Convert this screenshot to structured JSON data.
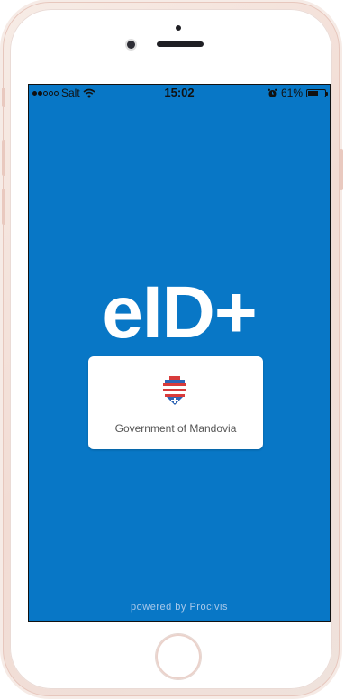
{
  "status_bar": {
    "carrier": "Salt",
    "time": "15:02",
    "battery_percent": "61%",
    "battery_level": 0.61,
    "signal_bars_filled": 2,
    "signal_bars_total": 5,
    "icons": [
      "signal-dots-icon",
      "wifi-icon",
      "alarm-icon",
      "battery-icon"
    ]
  },
  "app": {
    "logo_text": "eID+",
    "background_color": "#0877c6"
  },
  "government_card": {
    "name": "Government of Mandovia",
    "emblem_icon": "coat-of-arms-icon",
    "emblem_colors": [
      "#d83b3b",
      "#2e65b6"
    ]
  },
  "footer": {
    "powered_by": "powered by Procivis"
  }
}
